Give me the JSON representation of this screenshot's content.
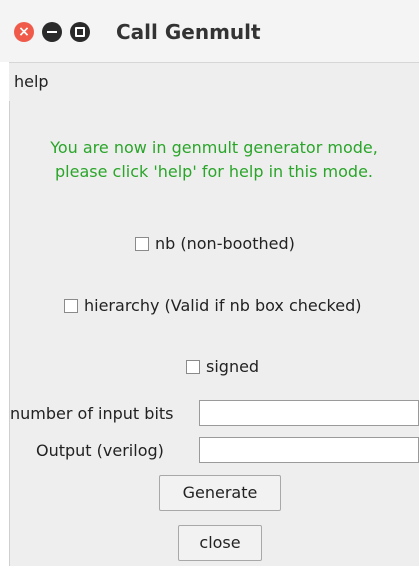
{
  "window": {
    "title": "Call Genmult",
    "close_glyph": "×"
  },
  "icons": {
    "close": "close-icon",
    "minimize": "minimize-icon",
    "maximize": "maximize-icon"
  },
  "colors": {
    "message_text": "#2aa52a",
    "close_button": "#f05a4a",
    "window_background": "#eeeeee"
  },
  "menu": {
    "help_label": "help"
  },
  "message": {
    "line1": "You are now in genmult generator mode,",
    "line2": "please click 'help' for help in this mode."
  },
  "options": {
    "nb_label": "nb (non-boothed)",
    "hierarchy_label": "hierarchy (Valid if nb box checked)",
    "signed_label": "signed"
  },
  "fields": {
    "input_bits_label": "number of input bits",
    "input_bits_value": "",
    "output_label": "Output (verilog)",
    "output_value": ""
  },
  "buttons": {
    "generate_label": "Generate",
    "close_label": "close"
  }
}
